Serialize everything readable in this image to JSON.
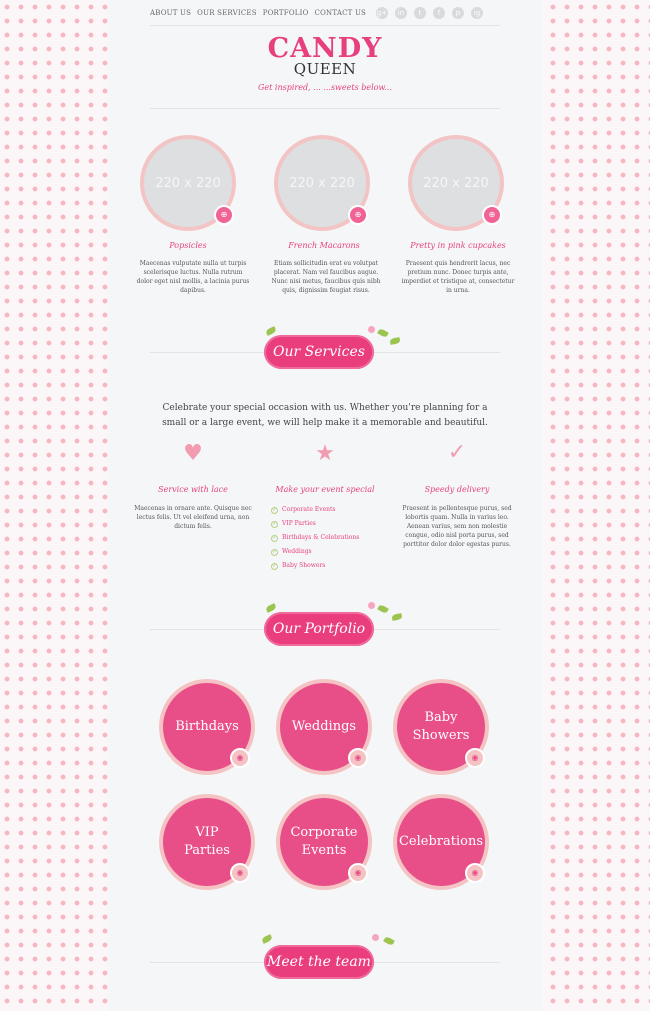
{
  "nav": [
    "ABOUT US",
    "OUR SERVICES",
    "PORTFOLIO",
    "CONTACT US"
  ],
  "social": [
    "g+",
    "in",
    "t",
    "f",
    "p",
    "ig"
  ],
  "logo": {
    "line1": "CANDY",
    "line2": "QUEEN"
  },
  "tagline": "Get inspired, ... ...sweets below...",
  "featured": [
    {
      "placeholder": "220 x 220",
      "title": "Popsicles",
      "text": "Maecenas vulputate nulla ut turpis scelerisque luctus. Nulla rutrum dolor eget nisl mollis, a lacinia purus dapibus."
    },
    {
      "placeholder": "220 x 220",
      "title": "French Macarons",
      "text": "Etiam sollicitudin erat eu volutpat placerat. Nam vel faucibus augue. Nunc nisi metus, faucibus quis nibh quis, dignissim feugiat risus."
    },
    {
      "placeholder": "220 x 220",
      "title": "Pretty in pink cupcakes",
      "text": "Praesent quis hendrerit lacus, nec pretium nunc. Donec turpis ante, imperdiet et tristique at, consectetur in urna."
    }
  ],
  "sections": {
    "services": "Our Services",
    "portfolio": "Our Portfolio",
    "team": "Meet the team"
  },
  "intro": "Celebrate your special occasion with us. Whether you're planning for a small or a large event, we will help make it a memorable and beautiful.",
  "services": [
    {
      "icon": "heart-icon",
      "title": "Service with lace",
      "text": "Maecenas in ornare ante. Quisque nec lectus felis. Ut vel eleifend urna, non dictum felis."
    },
    {
      "icon": "star-icon",
      "title": "Make your event special",
      "list": [
        "Corporate Events",
        "VIP Parties",
        "Birthdays & Celebrations",
        "Weddings",
        "Baby Showers"
      ]
    },
    {
      "icon": "check-icon",
      "title": "Speedy delivery",
      "text": "Praesent in pellentesque purus, sed lobortis quam. Nulla in varius leo. Aenean varius, sem non molestie congue, odio nisl porta purus, sed porttitor dolor dolor egestas purus."
    }
  ],
  "portfolio": [
    "Birthdays",
    "Weddings",
    "Baby Showers",
    "VIP Parties",
    "Corporate Events",
    "Celebrations"
  ],
  "colors": {
    "accent": "#e6417e",
    "soft_pink": "#f5c3c3",
    "background": "#f5f6f8"
  }
}
